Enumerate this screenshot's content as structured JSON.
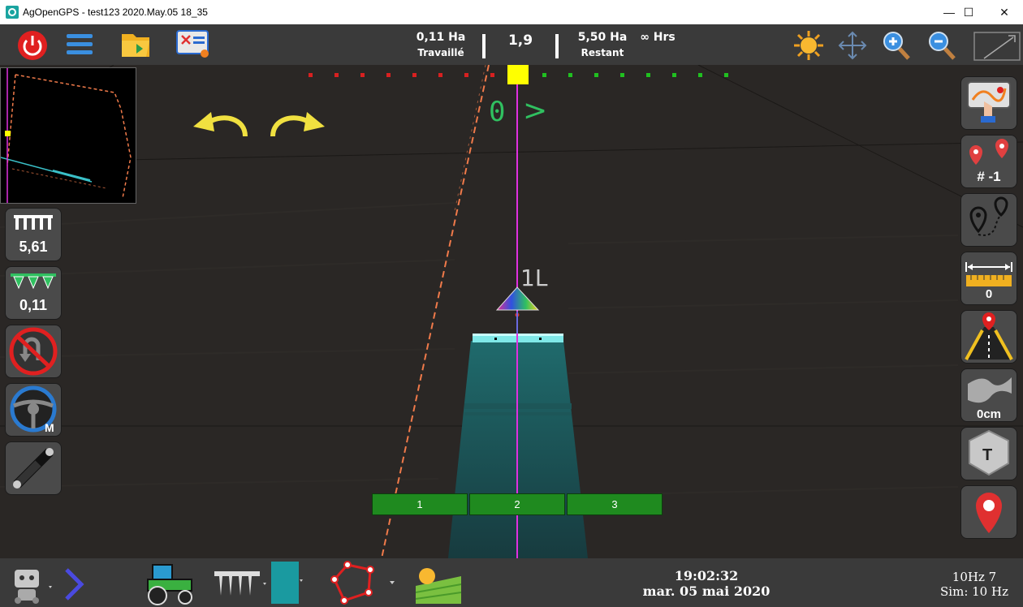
{
  "window": {
    "title": "AgOpenGPS - test123 2020.May.05 18_35",
    "minimize": "—",
    "maximize": "☐",
    "close": "✕"
  },
  "stats": {
    "worked_value": "0,11 Ha",
    "worked_label": "Travaillé",
    "speed": "1,9",
    "remaining_value": "5,50 Ha",
    "remaining_label": "Restant",
    "hours": "∞ Hrs"
  },
  "guidance": {
    "offset_value": "0",
    "offset_arrow": ">",
    "line_label": "1L"
  },
  "sections": [
    {
      "label": "1"
    },
    {
      "label": "2"
    },
    {
      "label": "3"
    }
  ],
  "left_panel": {
    "tool_width": "5,61",
    "applied_area": "0,11"
  },
  "right_panel": {
    "flags_count": "# -1",
    "snap_distance": "0",
    "nudge": "0cm",
    "tram_letter": "T"
  },
  "status": {
    "time": "19:02:32",
    "date": "mar. 05 mai 2020",
    "hz": "10Hz 7",
    "sim": "Sim: 10 Hz"
  },
  "colors": {
    "guidance_line": "#e030e0",
    "section_on": "#1f8a1f",
    "boundary": "#f07a4a",
    "toolbar_bg": "#3a3a3a",
    "lightbar_left": "#d82020",
    "lightbar_right": "#20c020",
    "lightbar_center": "#ffff00"
  }
}
